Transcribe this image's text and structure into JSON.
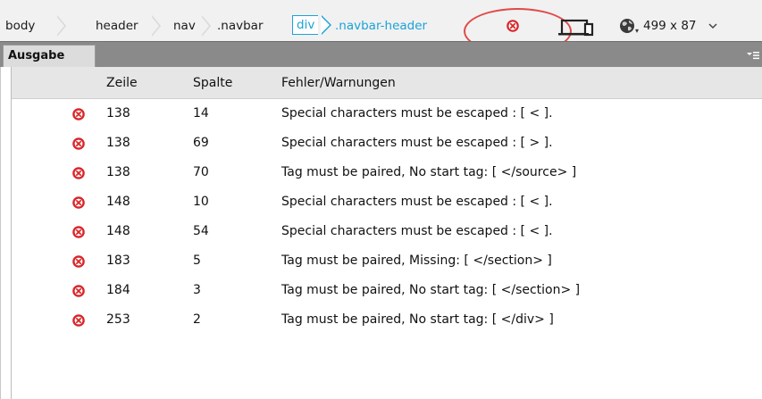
{
  "tag_selector": {
    "crumbs": [
      "body",
      "header",
      "nav",
      ".navbar"
    ],
    "active_tag": "div",
    "active_class": ".navbar-header",
    "window_size": "499 x 87"
  },
  "panel": {
    "tab_label": "Ausgabe"
  },
  "table": {
    "columns": [
      "Zeile",
      "Spalte",
      "Fehler/Warnungen"
    ],
    "rows": [
      {
        "line": "138",
        "column": "14",
        "message": "Special characters must be escaped : [ < ]."
      },
      {
        "line": "138",
        "column": "69",
        "message": "Special characters must be escaped : [ > ]."
      },
      {
        "line": "138",
        "column": "70",
        "message": "Tag must be paired, No start tag: [ </source> ]"
      },
      {
        "line": "148",
        "column": "10",
        "message": "Special characters must be escaped : [ < ]."
      },
      {
        "line": "148",
        "column": "54",
        "message": "Special characters must be escaped : [ < ]."
      },
      {
        "line": "183",
        "column": "5",
        "message": "Tag must be paired, Missing: [ </section> ]"
      },
      {
        "line": "184",
        "column": "3",
        "message": "Tag must be paired, No start tag: [ </section> ]"
      },
      {
        "line": "253",
        "column": "2",
        "message": "Tag must be paired, No start tag: [ </div> ]"
      }
    ]
  },
  "colors": {
    "error": "#d8262a",
    "accent": "#1aa3d7",
    "annotation": "#e04a4a"
  },
  "icons": {
    "status": "error-icon",
    "device": "device-preview-icon",
    "globe": "globe-icon",
    "panel_menu": "panel-menu-icon"
  }
}
